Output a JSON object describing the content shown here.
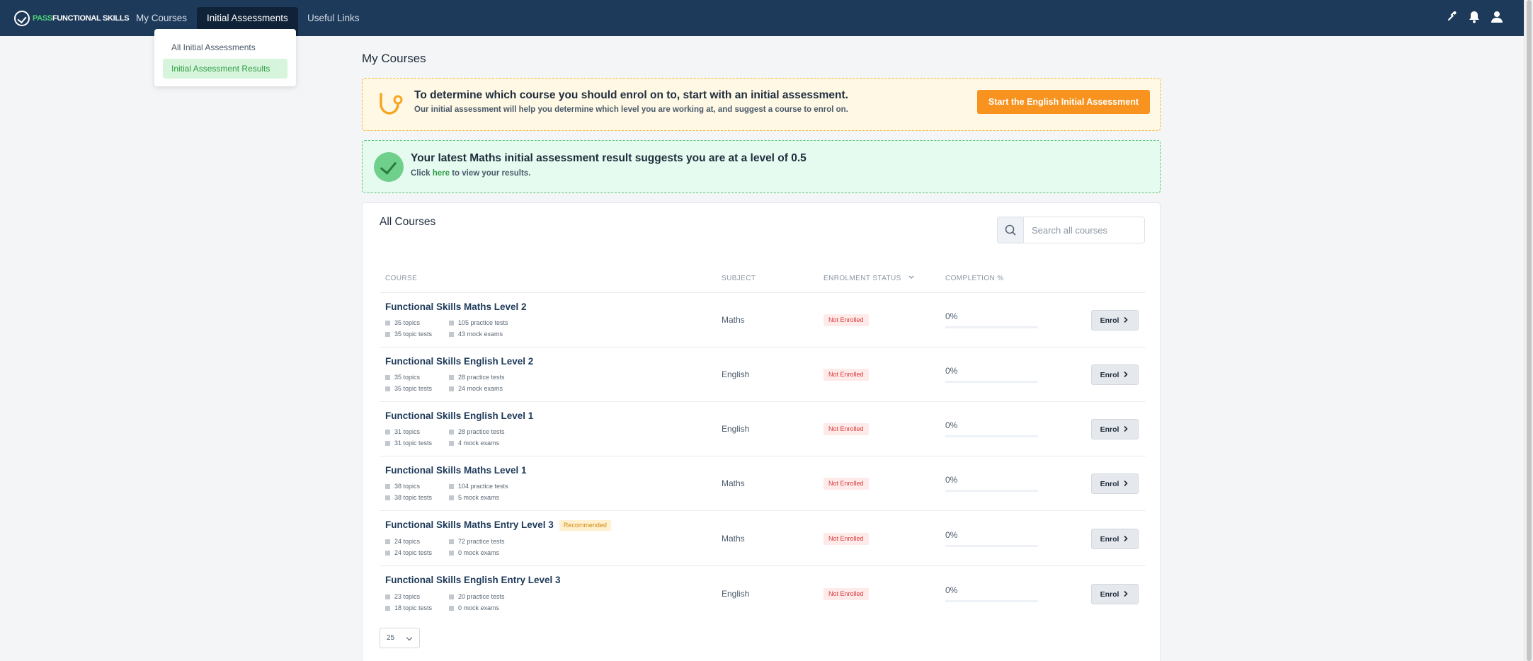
{
  "brand": {
    "logo_part1": "PASS",
    "logo_part2": "FUNCTIONAL SKILLS",
    "accent": "#4fd27a",
    "nav_bg": "#1e3a5a"
  },
  "nav": {
    "items": [
      {
        "label": "My Courses"
      },
      {
        "label": "Initial Assessments"
      },
      {
        "label": "Useful Links"
      }
    ],
    "icons": [
      "rocket-icon",
      "bell-icon",
      "user-icon"
    ]
  },
  "dropdown": {
    "items": [
      {
        "label": "All Initial Assessments"
      },
      {
        "label": "Initial Assessment Results"
      }
    ]
  },
  "page": {
    "title": "My Courses"
  },
  "banner_assessment": {
    "title": "To determine which course you should enrol on to, start with an initial assessment.",
    "subtitle": "Our initial assessment will help you determine which level you are working at, and suggest a course to enrol on.",
    "cta": "Start the English Initial Assessment"
  },
  "banner_result": {
    "title": "Your latest Maths initial assessment result suggests you are at a level of 0.5",
    "sub_prefix": "Click",
    "sub_link": "here",
    "sub_suffix": "to view your results."
  },
  "courses_card": {
    "title": "All Courses",
    "search_placeholder": "Search all courses",
    "columns": {
      "course": "COURSE",
      "subject": "SUBJECT",
      "status": "ENROLMENT STATUS",
      "completion": "COMPLETION %"
    },
    "enrol_label": "Enrol",
    "page_size": "25",
    "rows": [
      {
        "name": "Functional Skills Maths Level 2",
        "badge": "",
        "topics": "35 topics",
        "topic_tests": "35 topic tests",
        "practice": "105 practice tests",
        "mock": "43 mock exams",
        "subject": "Maths",
        "status": "Not Enrolled",
        "completion": "0%",
        "progress": 0
      },
      {
        "name": "Functional Skills English Level 2",
        "badge": "",
        "topics": "35 topics",
        "topic_tests": "35 topic tests",
        "practice": "28 practice tests",
        "mock": "24 mock exams",
        "subject": "English",
        "status": "Not Enrolled",
        "completion": "0%",
        "progress": 0
      },
      {
        "name": "Functional Skills English Level 1",
        "badge": "",
        "topics": "31 topics",
        "topic_tests": "31 topic tests",
        "practice": "28 practice tests",
        "mock": "4 mock exams",
        "subject": "English",
        "status": "Not Enrolled",
        "completion": "0%",
        "progress": 0
      },
      {
        "name": "Functional Skills Maths Level 1",
        "badge": "",
        "topics": "38 topics",
        "topic_tests": "38 topic tests",
        "practice": "104 practice tests",
        "mock": "5 mock exams",
        "subject": "Maths",
        "status": "Not Enrolled",
        "completion": "0%",
        "progress": 0
      },
      {
        "name": "Functional Skills Maths Entry Level 3",
        "badge": "Recommended",
        "topics": "24 topics",
        "topic_tests": "24 topic tests",
        "practice": "72 practice tests",
        "mock": "0 mock exams",
        "subject": "Maths",
        "status": "Not Enrolled",
        "completion": "0%",
        "progress": 0
      },
      {
        "name": "Functional Skills English Entry Level 3",
        "badge": "",
        "topics": "23 topics",
        "topic_tests": "18 topic tests",
        "practice": "20 practice tests",
        "mock": "0 mock exams",
        "subject": "English",
        "status": "Not Enrolled",
        "completion": "0%",
        "progress": 0
      }
    ]
  }
}
